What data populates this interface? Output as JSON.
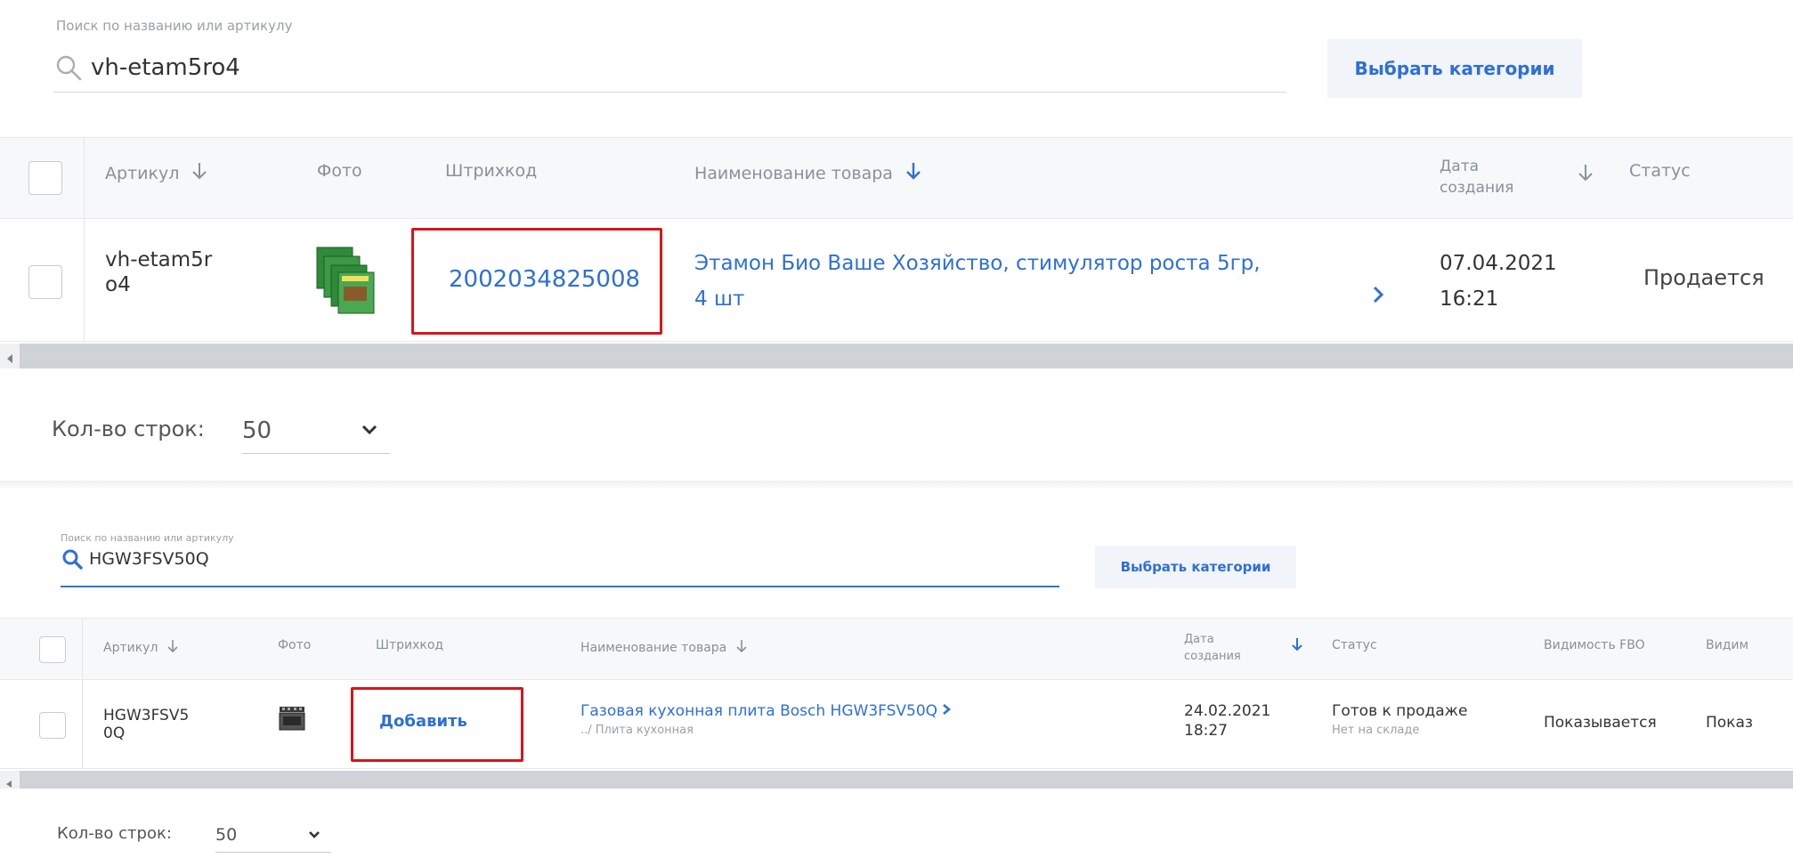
{
  "panel1": {
    "search": {
      "label": "Поиск по названию или артикулу",
      "value": "vh-etam5ro4"
    },
    "categories_button": "Выбрать категории",
    "columns": {
      "article": "Артикул",
      "photo": "Фото",
      "barcode": "Штрихкод",
      "name": "Наименование товара",
      "date_line1": "Дата",
      "date_line2": "создания",
      "status": "Статус"
    },
    "row": {
      "article_line1": "vh-etam5r",
      "article_line2": "o4",
      "barcode": "2002034825008",
      "name_line1": "Этамон Био Ваше Хозяйство, стимулятор роста 5гр,",
      "name_line2": "4 шт",
      "date": "07.04.2021",
      "time": "16:21",
      "status": "Продается"
    },
    "rows_count": {
      "label": "Кол-во строк:",
      "value": "50"
    }
  },
  "panel2": {
    "search": {
      "label": "Поиск по названию или артикулу",
      "value": "HGW3FSV50Q"
    },
    "categories_button": "Выбрать категории",
    "columns": {
      "article": "Артикул",
      "photo": "Фото",
      "barcode": "Штрихкод",
      "name": "Наименование товара",
      "date_line1": "Дата",
      "date_line2": "создания",
      "status": "Статус",
      "visibility_fbo": "Видимость FBO",
      "visibility_more": "Видим"
    },
    "row": {
      "article_line1": "HGW3FSV5",
      "article_line2": "0Q",
      "barcode_action": "Добавить",
      "name": "Газовая кухонная плита Bosch HGW3FSV50Q",
      "category": "../ Плита кухонная",
      "date": "24.02.2021",
      "time": "18:27",
      "status": "Готов к продаже",
      "substatus": "Нет на складе",
      "visibility_fbo": "Показывается",
      "visibility_more": "Показ"
    },
    "rows_count": {
      "label": "Кол-во строк:",
      "value": "50"
    }
  },
  "icons": {
    "search": "search-icon",
    "sort": "arrow-down-icon",
    "chevron_right": "chevron-right-icon",
    "chevron_down": "chevron-down-icon",
    "scroll_left": "scroll-left-icon"
  },
  "colors": {
    "link": "#2e6fd8",
    "highlight": "#d7151b",
    "header_bg": "#f7f8fa",
    "button_bg": "#f1f4f8"
  }
}
